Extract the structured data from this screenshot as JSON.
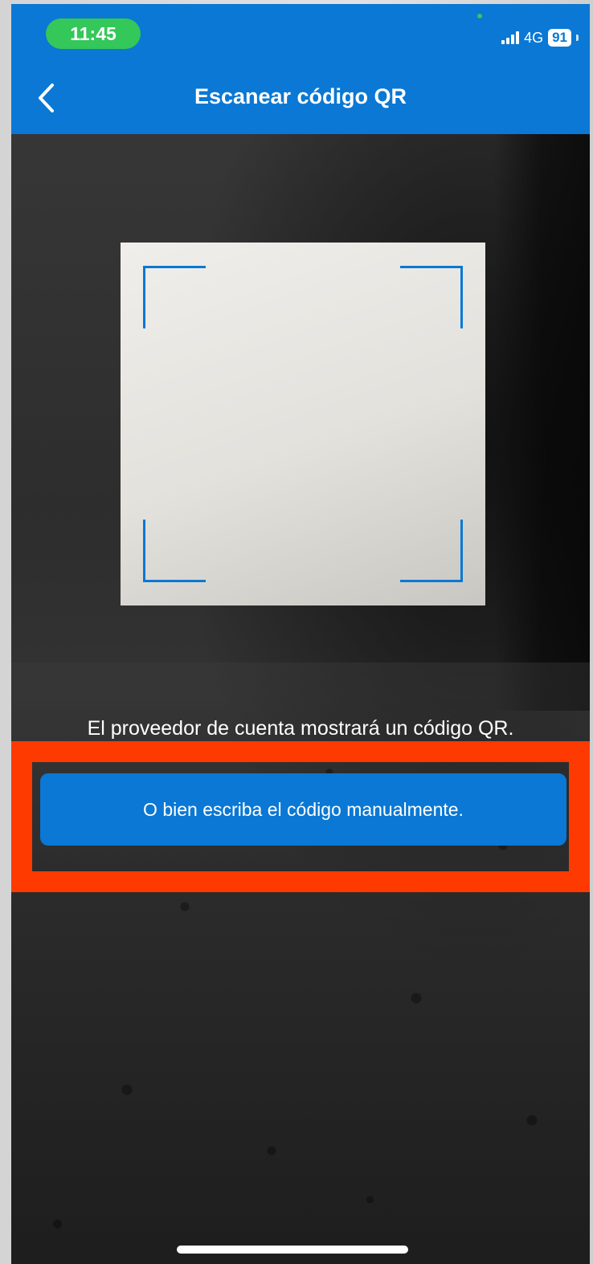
{
  "status_bar": {
    "time": "11:45",
    "network": "4G",
    "battery": "91"
  },
  "nav": {
    "title": "Escanear código QR"
  },
  "scanner": {
    "instruction": "El proveedor de cuenta mostrará un código QR."
  },
  "actions": {
    "manual_entry_label": "O bien escriba el código manualmente."
  },
  "colors": {
    "accent": "#0a78d4",
    "highlight": "#ff3a00",
    "time_pill": "#34c759"
  }
}
